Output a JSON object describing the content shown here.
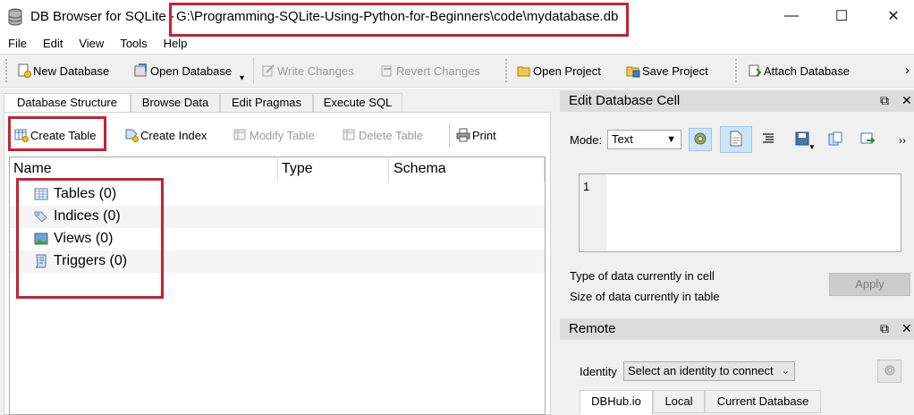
{
  "window": {
    "title": "DB Browser for SQLite -",
    "path": "G:\\Programming-SQLite-Using-Python-for-Beginners\\code\\mydatabase.db",
    "min_glyph": "—",
    "max_glyph": "☐",
    "close_glyph": "✕"
  },
  "menu": [
    "File",
    "Edit",
    "View",
    "Tools",
    "Help"
  ],
  "toolbar": {
    "new_database": "New Database",
    "open_database": "Open Database",
    "write_changes": "Write Changes",
    "revert_changes": "Revert Changes",
    "open_project": "Open Project",
    "save_project": "Save Project",
    "attach_database": "Attach Database",
    "overflow": "›",
    "dropdown_glyph": "▾"
  },
  "tabs": {
    "structure": "Database Structure",
    "browse": "Browse Data",
    "pragmas": "Edit Pragmas",
    "sql": "Execute SQL"
  },
  "structure_toolbar": {
    "create_table": "Create Table",
    "create_index": "Create Index",
    "modify_table": "Modify Table",
    "delete_table": "Delete Table",
    "print": "Print"
  },
  "tree": {
    "columns": {
      "name": "Name",
      "type": "Type",
      "schema": "Schema"
    },
    "items": [
      {
        "label": "Tables (0)"
      },
      {
        "label": "Indices (0)"
      },
      {
        "label": "Views (0)"
      },
      {
        "label": "Triggers (0)"
      }
    ]
  },
  "edit_cell": {
    "title": "Edit Database Cell",
    "float_glyph": "⧉",
    "close_glyph": "✕",
    "mode_label": "Mode:",
    "mode_value": "Text",
    "more_glyph": "››",
    "line_number": "1",
    "type_info": "Type of data currently in cell",
    "size_info": "Size of data currently in table",
    "apply": "Apply"
  },
  "remote": {
    "title": "Remote",
    "identity_label": "Identity",
    "identity_value": "Select an identity to connect",
    "tabs": {
      "dbhub": "DBHub.io",
      "local": "Local",
      "current": "Current Database"
    }
  },
  "colors": {
    "highlight_box": "#c8202f",
    "dock_title_bg": "#dcdcdc",
    "toolbar_bg": "#f0f0f0"
  }
}
